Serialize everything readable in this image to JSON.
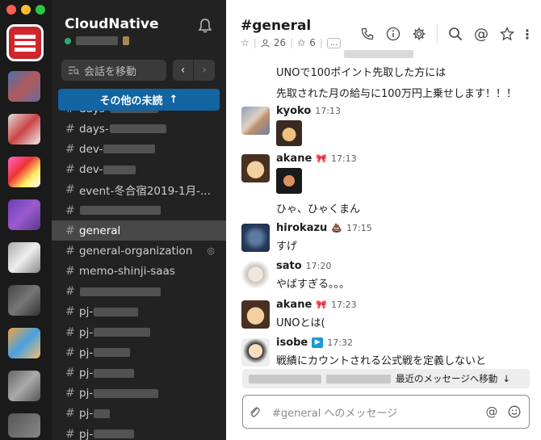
{
  "window": {
    "controls": [
      "close",
      "minimize",
      "zoom"
    ]
  },
  "sidebar": {
    "workspace_name": "CloudNative",
    "jump_placeholder": "会話を移動",
    "unread_button": "その他の未読",
    "unread_arrow": "↑",
    "channels": [
      {
        "name": "days-"
      },
      {
        "name": "days-"
      },
      {
        "name": "dev-"
      },
      {
        "name": "dev-"
      },
      {
        "name": "event-冬合宿2019-1月-..."
      },
      {
        "name": ""
      },
      {
        "name": "general",
        "active": true
      },
      {
        "name": "general-organization",
        "shared": true
      },
      {
        "name": "memo-shinji-saas"
      },
      {
        "name": ""
      },
      {
        "name": "pj-"
      },
      {
        "name": "pj-"
      },
      {
        "name": "pj-"
      },
      {
        "name": "pj-"
      },
      {
        "name": "pj-"
      },
      {
        "name": "pj-"
      },
      {
        "name": "pj-"
      }
    ]
  },
  "channel": {
    "title": "#general",
    "member_count": "26",
    "pinned_count": "6",
    "more": "..."
  },
  "messages": {
    "continuation": [
      "UNOで100ポイント先取した方には",
      "先取された月の給与に100万円上乗せします！！！"
    ],
    "items": [
      {
        "name": "kyoko",
        "time": "17:13",
        "body": ""
      },
      {
        "name": "akane",
        "time": "17:13",
        "body": ""
      },
      {
        "name": "",
        "time": "",
        "body": "ひゃ、ひゃくまん"
      },
      {
        "name": "hirokazu",
        "time": "17:15",
        "body": "すげ"
      },
      {
        "name": "sato",
        "time": "17:20",
        "body": "やばすぎる。。。"
      },
      {
        "name": "akane",
        "time": "17:23",
        "body": "UNOとは("
      },
      {
        "name": "isobe",
        "time": "17:32",
        "body": "戦績にカウントされる公式戦を定義しないと"
      }
    ]
  },
  "banner": {
    "text": "最近のメッセージへ移動",
    "arrow": "↓"
  },
  "composer": {
    "placeholder": "#general へのメッセージ"
  },
  "colors": {
    "rail_bg": "#1a1a1a",
    "sidebar_bg": "#222222",
    "active_channel_bg": "#484848",
    "unread_button": "#1264a3",
    "presence_green": "#2bac76"
  },
  "icons": [
    "bell-icon",
    "search-icon",
    "phone-icon",
    "info-icon",
    "gear-icon",
    "at-icon",
    "star-icon",
    "kebab-icon",
    "paperclip-icon",
    "emoji-icon",
    "video-icon"
  ]
}
